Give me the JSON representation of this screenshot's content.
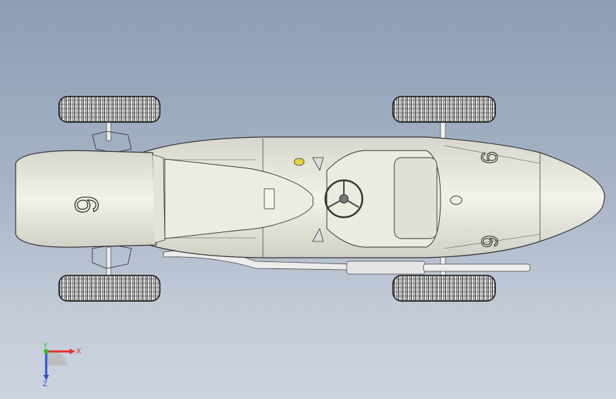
{
  "viewport": {
    "background_top": "#8d9db5",
    "background_bottom": "#cdd4de"
  },
  "model": {
    "race_number": "6",
    "body_color": "#e6e6dc",
    "tire_color": "#2a2a2a"
  },
  "triad": {
    "x_label": "X",
    "y_label": "Y",
    "z_label": "Z",
    "x_color": "#e03030",
    "y_color": "#30c030",
    "z_color": "#3050d0"
  }
}
